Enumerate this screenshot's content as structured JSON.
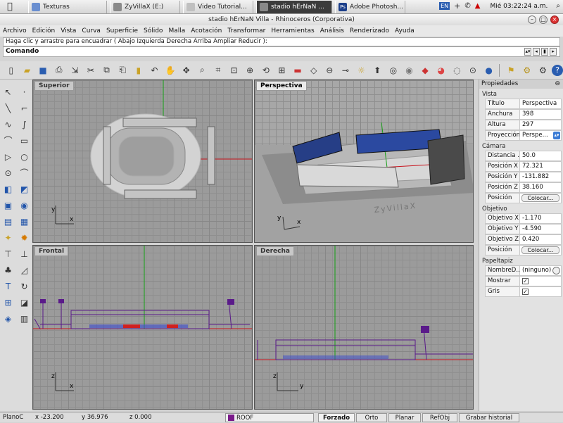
{
  "taskbar": {
    "tasks": [
      {
        "label": "Texturas",
        "color": "#6a8fd0",
        "active": false
      },
      {
        "label": "ZyVillaX (E:)",
        "color": "#8a8a8a",
        "active": false
      },
      {
        "label": "Video Tutorial...",
        "color": "#c0c0c0",
        "active": false
      },
      {
        "label": "stadio hErNaN ...",
        "color": "#333333",
        "active": true
      },
      {
        "label": "Adobe Photosh...",
        "color": "#1c3f8a",
        "active": false
      }
    ],
    "lang": "EN",
    "clock": "Mié 03:22:24 a.m."
  },
  "window": {
    "title": "stadio hErNaN Villa - Rhinoceros (Corporativa)"
  },
  "menu": [
    "Archivo",
    "Edición",
    "Vista",
    "Curva",
    "Superficie",
    "Sólido",
    "Malla",
    "Acotación",
    "Transformar",
    "Herramientas",
    "Análisis",
    "Renderizado",
    "Ayuda"
  ],
  "command": {
    "history": "Haga clic y arrastre para encuadrar ( Abajo  Izquierda  Derecha  Arriba  Ampliar  Reducir ):",
    "prompt": "Comando:",
    "value": ""
  },
  "viewports": {
    "top": {
      "label": "Superior"
    },
    "perspective": {
      "label": "Perspectiva",
      "watermark": "ZyVillaX"
    },
    "front": {
      "label": "Frontal"
    },
    "right": {
      "label": "Derecha"
    },
    "axis_x": "x",
    "axis_y": "y",
    "axis_z": "z"
  },
  "properties": {
    "header": "Propiedades",
    "vista": {
      "title": "Vista",
      "rows": [
        {
          "key": "Título",
          "value": "Perspectiva"
        },
        {
          "key": "Anchura",
          "value": "398"
        },
        {
          "key": "Altura",
          "value": "297"
        },
        {
          "key": "Proyección",
          "value": "Perspe..."
        }
      ]
    },
    "camara": {
      "title": "Cámara",
      "rows": [
        {
          "key": "Distancia ...",
          "value": "50.0"
        },
        {
          "key": "Posición X",
          "value": "72.321"
        },
        {
          "key": "Posición Y",
          "value": "-131.882"
        },
        {
          "key": "Posición Z",
          "value": "38.160"
        },
        {
          "key": "Posición",
          "value": "Colocar..."
        }
      ]
    },
    "objetivo": {
      "title": "Objetivo",
      "rows": [
        {
          "key": "Objetivo X",
          "value": "-1.170"
        },
        {
          "key": "Objetivo Y",
          "value": "-4.590"
        },
        {
          "key": "Objetivo Z",
          "value": "0.420"
        },
        {
          "key": "Posición",
          "value": "Colocar..."
        }
      ]
    },
    "papeltapiz": {
      "title": "Papeltapiz",
      "rows": [
        {
          "key": "NombreD...",
          "value": "(ninguno)"
        },
        {
          "key": "Mostrar",
          "value": ""
        },
        {
          "key": "Gris",
          "value": ""
        }
      ]
    }
  },
  "status": {
    "plane": "PlanoC",
    "x": "x -23.200",
    "y": "y 36.976",
    "z": "z 0.000",
    "layer": "ROOF",
    "layer_color": "#7a1a8a",
    "buttons": [
      "Forzado",
      "Orto",
      "Planar",
      "RefObj",
      "Grabar historial"
    ]
  }
}
